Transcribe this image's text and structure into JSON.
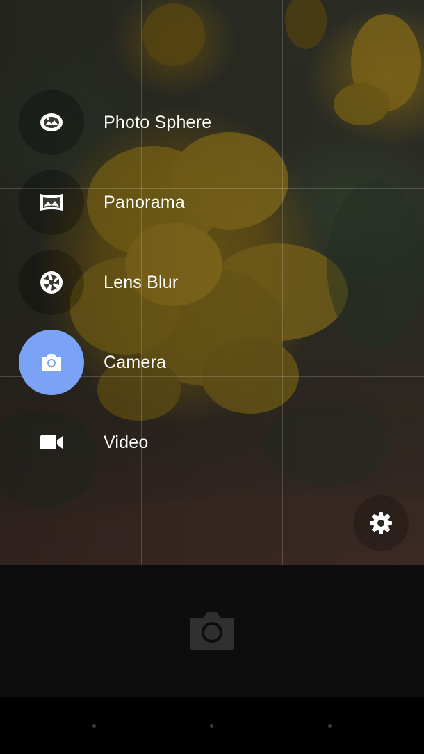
{
  "modes": [
    {
      "label": "Photo Sphere",
      "icon": "photo-sphere-icon",
      "active": false
    },
    {
      "label": "Panorama",
      "icon": "panorama-icon",
      "active": false
    },
    {
      "label": "Lens Blur",
      "icon": "lens-blur-icon",
      "active": false
    },
    {
      "label": "Camera",
      "icon": "camera-icon",
      "active": true
    },
    {
      "label": "Video",
      "icon": "video-icon",
      "active": false
    }
  ],
  "settings": {
    "icon": "gear-icon"
  },
  "shutter": {
    "icon": "camera-shutter-icon"
  },
  "colors": {
    "active_mode": "#7ba3f5",
    "text": "#ffffff",
    "bottom_bar": "#0d0d0d"
  }
}
